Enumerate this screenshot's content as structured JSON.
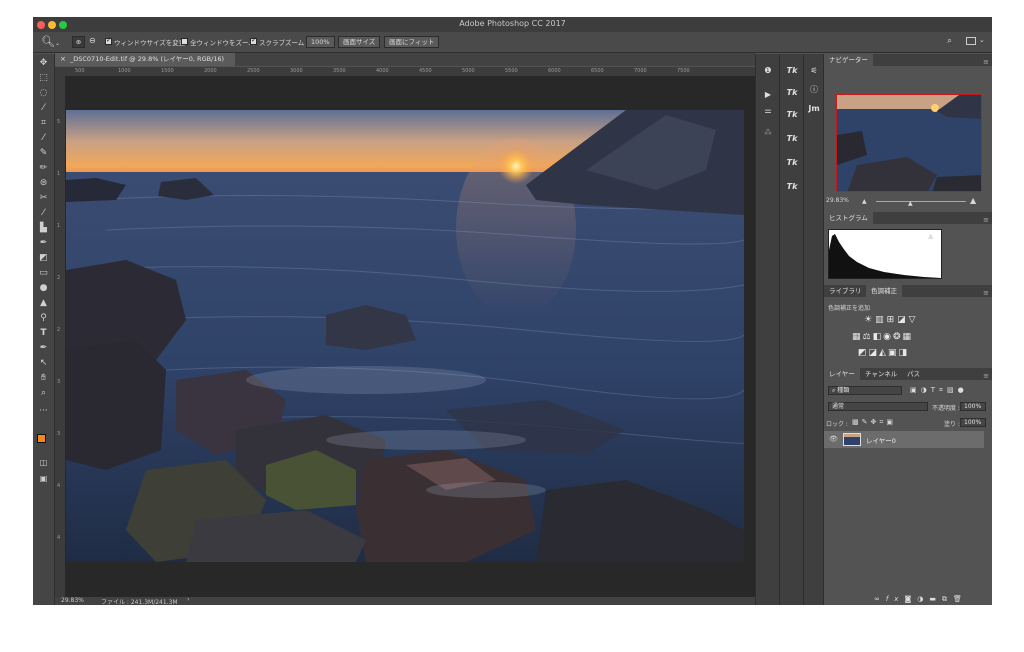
{
  "window": {
    "title": "Adobe Photoshop CC 2017",
    "traffic_lights": [
      "#fc5f57",
      "#fdbc2e",
      "#28c840"
    ]
  },
  "options_bar": {
    "tool_icon": "zoom-icon",
    "resize_windows_label": "ウィンドウサイズを変更",
    "zoom_all_windows_label": "全ウィンドウをズーム",
    "scrubby_zoom_label": "スクラブズーム",
    "zoom_100_label": "100%",
    "fit_screen_label": "画面サイズ",
    "fill_screen_label": "画面にフィット"
  },
  "document": {
    "tab_label": "_DSC0710-Edit.tif @ 29.8% (レイヤー0, RGB/16)",
    "ruler_top_ticks": [
      "500",
      "1000",
      "1500",
      "2000",
      "2500",
      "3000",
      "3500",
      "4000",
      "4500",
      "5000",
      "5500",
      "6000",
      "6500",
      "7000",
      "7500"
    ],
    "ruler_left_ticks": [
      "5",
      "1",
      "1",
      "2",
      "2",
      "3",
      "3",
      "4",
      "4"
    ]
  },
  "status_bar": {
    "zoom": "29.83%",
    "file_info": "ファイル : 241.3M/241.3M",
    "arrow": "›"
  },
  "tools": [
    "move-icon",
    "marquee-icon",
    "lasso-icon",
    "quick-select-icon",
    "crop-icon",
    "eyedropper-icon",
    "healing-icon",
    "brush-icon",
    "stamp-icon",
    "history-brush-icon",
    "eraser-icon",
    "gradient-icon",
    "blur-icon",
    "dodge-icon",
    "pen-icon",
    "type-icon",
    "path-select-icon",
    "shape-icon",
    "hand-icon",
    "zoom-icon",
    "more-icon"
  ],
  "mid_panel_icons": {
    "col1": [
      "history-icon",
      "play-icon",
      "tool-presets-icon",
      "brushes-icon"
    ],
    "col2": [
      "Tk",
      "Tk",
      "Tk",
      "Tk",
      "Tk",
      "Tk"
    ],
    "col3": [
      "properties-icon",
      "info-icon",
      "Jm"
    ]
  },
  "navigator": {
    "tab": "ナビゲーター",
    "zoom": "29.83%"
  },
  "histogram": {
    "tab": "ヒストグラム"
  },
  "adjustments": {
    "tab_libraries": "ライブラリ",
    "tab_adjustments": "色調補正",
    "add_label": "色調補正を追加"
  },
  "layers": {
    "tab_layers": "レイヤー",
    "tab_channels": "チャンネル",
    "tab_paths": "パス",
    "filter_kind": "種類",
    "blend_mode": "通常",
    "opacity_label": "不透明度 :",
    "opacity_value": "100%",
    "lock_label": "ロック :",
    "fill_label": "塗り :",
    "fill_value": "100%",
    "layer_name": "レイヤー0",
    "footer_icons": [
      "link-icon",
      "fx-icon",
      "mask-icon",
      "adjustment-icon",
      "folder-icon",
      "new-layer-icon",
      "trash-icon"
    ]
  }
}
